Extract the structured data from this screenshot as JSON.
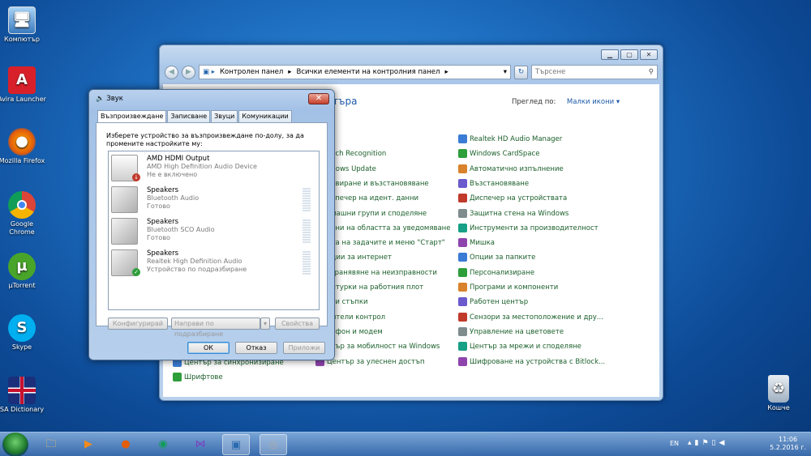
{
  "desktop_icons": [
    {
      "label": "Компютър"
    },
    {
      "label": "Avira Launcher"
    },
    {
      "label": "Mozilla Firefox"
    },
    {
      "label": "Google Chrome"
    },
    {
      "label": "µTorrent"
    },
    {
      "label": "Skype"
    },
    {
      "label": "SA Dictionary"
    },
    {
      "label": "Кошче"
    }
  ],
  "control_panel": {
    "breadcrumb": [
      "Контролен панел",
      "Всички елементи на контролния панел"
    ],
    "search_placeholder": "Търсене",
    "header_partial": "търа",
    "view_by_label": "Преглед по:",
    "view_by_value": "Малки икони",
    "col1": [
      "ail",
      "eech Recognition",
      "ndows Update",
      "хивиране и възстановяване",
      "испечер на идент. данни",
      "омашни групи и споделяне",
      "кони на областта за уведомяване",
      "нта на задачите и меню \"Старт\"",
      "пции за интернет",
      "странявяне на неизправности",
      "ритурки на работния плот",
      "рви стъпки",
      "дители контрол",
      "лефон и модем",
      "нтър за мобилност на Windows",
      "Център за улеснен достъп"
    ],
    "col0": [
      "Център за синхронизиране",
      "Шрифтове"
    ],
    "col2": [
      "Realtek HD Audio Manager",
      "Windows CardSpace",
      "Автоматично изпълнение",
      "Възстановяване",
      "Диспечер на устройствата",
      "Защитна стена на Windows",
      "Инструменти за производителност",
      "Мишка",
      "Опции за папките",
      "Персонализиране",
      "Програми и компоненти",
      "Работен център",
      "Сензори за местоположение и дру...",
      "Управление на цветовете",
      "Център за мрежи и споделяне",
      "Шифроване на устройства с Bitlock..."
    ]
  },
  "sound_dialog": {
    "title": "Звук",
    "tabs": [
      "Възпроизвеждане",
      "Записване",
      "Звуци",
      "Комуникации"
    ],
    "instruction": "Изберете устройство за възпроизвеждане по-долу, за да промените настройките му:",
    "devices": [
      {
        "name": "AMD HDMI Output",
        "desc": "AMD High Definition Audio Device",
        "status": "Не е включено"
      },
      {
        "name": "Speakers",
        "desc": "Bluetooth Audio",
        "status": "Готово"
      },
      {
        "name": "Speakers",
        "desc": "Bluetooth SCO Audio",
        "status": "Готово"
      },
      {
        "name": "Speakers",
        "desc": "Realtek High Definition Audio",
        "status": "Устройство по подразбиране"
      }
    ],
    "btn_configure": "Конфигурирай",
    "btn_default": "Направи по подразбиране",
    "btn_properties": "Свойства",
    "btn_ok": "ОК",
    "btn_cancel": "Отказ",
    "btn_apply": "Приложи"
  },
  "taskbar": {
    "lang": "EN",
    "time": "11:06",
    "date": "5.2.2016 г."
  }
}
